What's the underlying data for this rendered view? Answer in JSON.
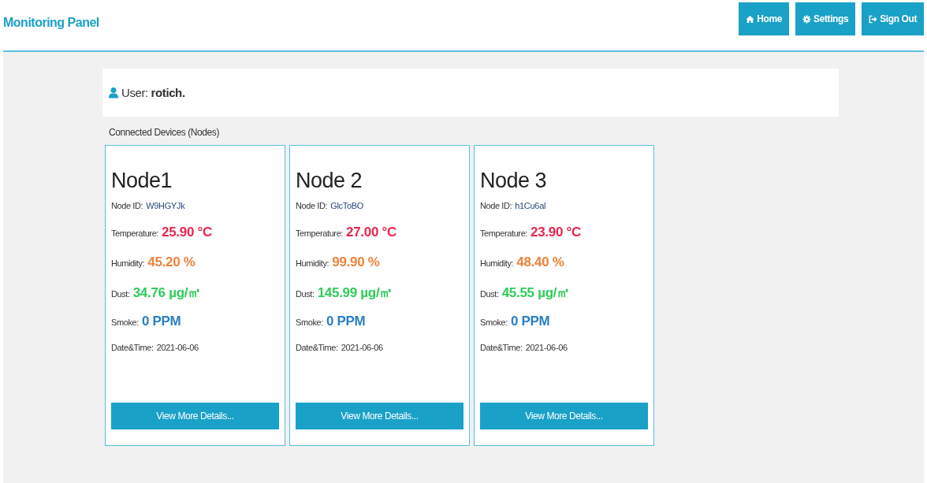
{
  "header": {
    "title": "Monitoring Panel",
    "buttons": [
      {
        "kind": "home",
        "label": "Home"
      },
      {
        "kind": "settings",
        "label": "Settings"
      },
      {
        "kind": "signout",
        "label": "Sign Out"
      }
    ]
  },
  "user": {
    "label": "User:",
    "name": "rotich."
  },
  "section_title": "Connected Devices (Nodes)",
  "nodes": [
    {
      "name": "Node1",
      "id_label": "Node ID:",
      "id": "W9HGYJk",
      "readings": [
        {
          "kind": "temperature",
          "label": "Temperature:",
          "value": "25.90 °C"
        },
        {
          "kind": "humidity",
          "label": "Humidity:",
          "value": "45.20 %"
        },
        {
          "kind": "dust",
          "label": "Dust:",
          "value": "34.76 µg/㎥"
        },
        {
          "kind": "smoke",
          "label": "Smoke:",
          "value": "0 PPM"
        }
      ],
      "date_label": "Date&Time:",
      "date": "2021-06-06",
      "button": "View More Details..."
    },
    {
      "name": "Node 2",
      "id_label": "Node ID:",
      "id": "GlcToBO",
      "readings": [
        {
          "kind": "temperature",
          "label": "Temperature:",
          "value": "27.00 °C"
        },
        {
          "kind": "humidity",
          "label": "Humidity:",
          "value": "99.90 %"
        },
        {
          "kind": "dust",
          "label": "Dust:",
          "value": "145.99 µg/㎥"
        },
        {
          "kind": "smoke",
          "label": "Smoke:",
          "value": "0 PPM"
        }
      ],
      "date_label": "Date&Time:",
      "date": "2021-06-06",
      "button": "View More Details..."
    },
    {
      "name": "Node 3",
      "id_label": "Node ID:",
      "id": "h1Cu6al",
      "readings": [
        {
          "kind": "temperature",
          "label": "Temperature:",
          "value": "23.90 °C"
        },
        {
          "kind": "humidity",
          "label": "Humidity:",
          "value": "48.40 %"
        },
        {
          "kind": "dust",
          "label": "Dust:",
          "value": "45.55 µg/㎥"
        },
        {
          "kind": "smoke",
          "label": "Smoke:",
          "value": "0 PPM"
        }
      ],
      "date_label": "Date&Time:",
      "date": "2021-06-06",
      "button": "View More Details..."
    }
  ]
}
